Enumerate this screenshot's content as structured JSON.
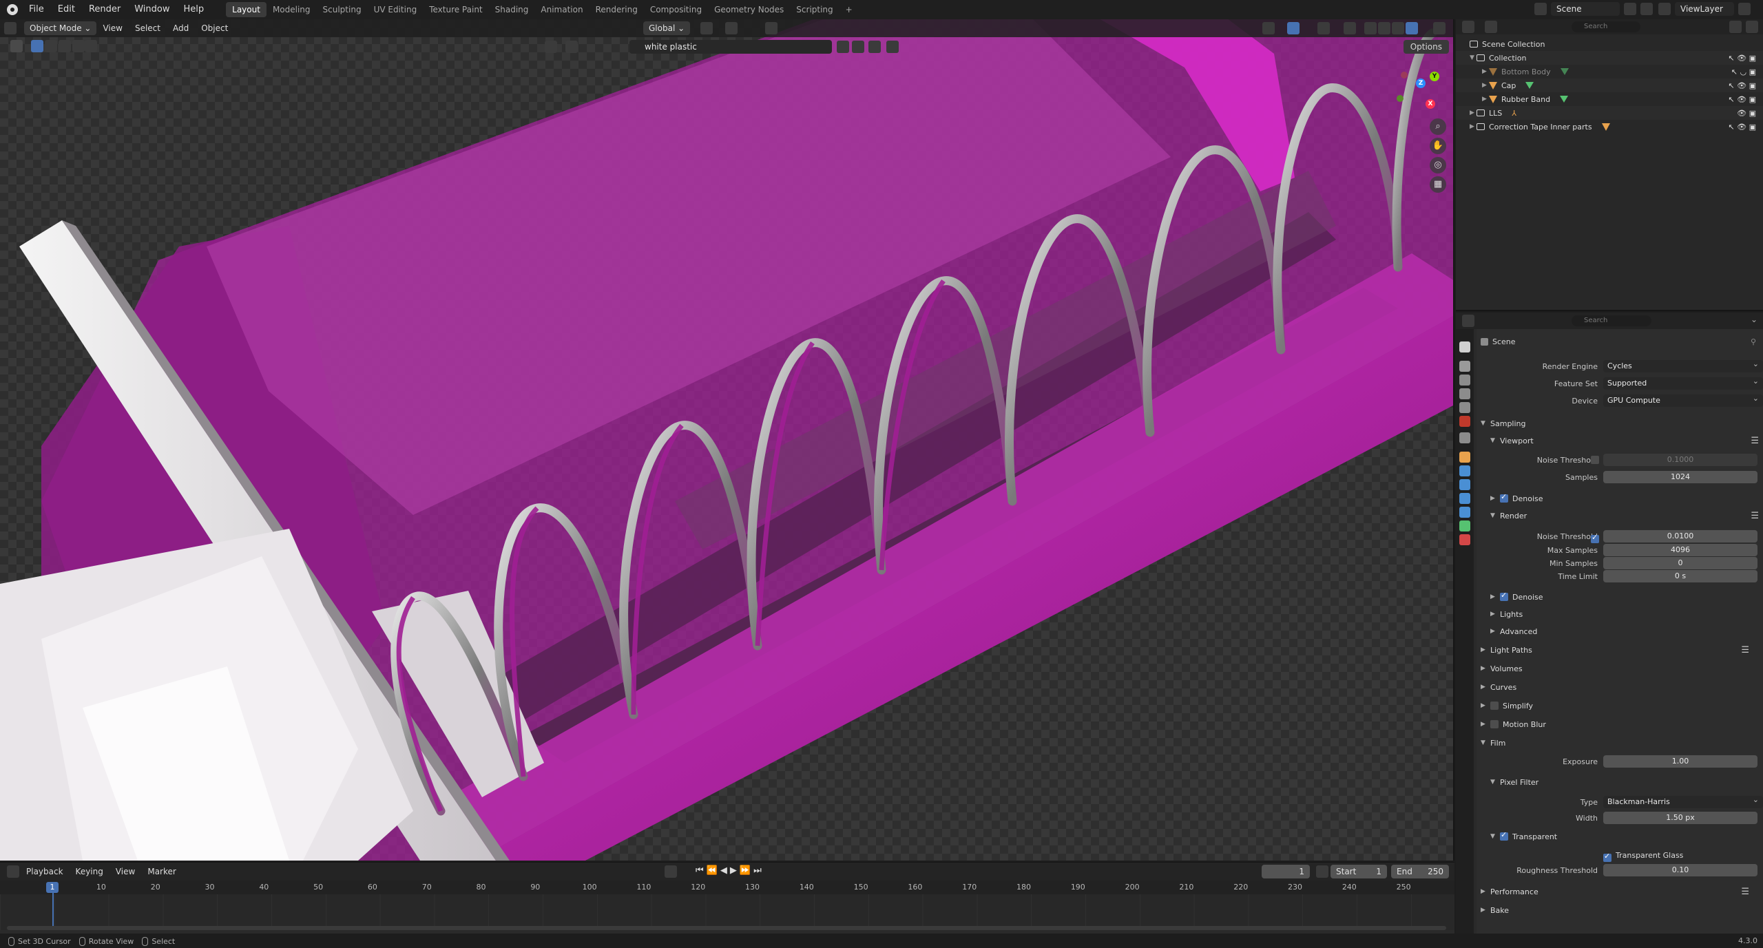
{
  "menubar": {
    "menus": [
      "File",
      "Edit",
      "Render",
      "Window",
      "Help"
    ],
    "workspaces": [
      "Layout",
      "Modeling",
      "Sculpting",
      "UV Editing",
      "Texture Paint",
      "Shading",
      "Animation",
      "Rendering",
      "Compositing",
      "Geometry Nodes",
      "Scripting"
    ],
    "active_workspace": "Layout",
    "add_tab": "+",
    "scene": "Scene",
    "view_layer": "ViewLayer"
  },
  "viewport": {
    "mode": "Object Mode",
    "menus": [
      "View",
      "Select",
      "Add",
      "Object"
    ],
    "orientation": "Global",
    "search_value": "white plastic",
    "options_label": "Options",
    "gizmo": {
      "x": "X",
      "y": "Y",
      "z": "Z"
    }
  },
  "timeline": {
    "menus": [
      "Playback",
      "Keying",
      "View",
      "Marker"
    ],
    "current_frame": "1",
    "start_label": "Start",
    "start_value": "1",
    "end_label": "End",
    "end_value": "250",
    "ruler": [
      "10",
      "20",
      "30",
      "40",
      "50",
      "60",
      "70",
      "80",
      "90",
      "100",
      "110",
      "120",
      "130",
      "140",
      "150",
      "160",
      "170",
      "180",
      "190",
      "200",
      "210",
      "220",
      "230",
      "240",
      "250"
    ],
    "playhead_frame": "1"
  },
  "statusbar": {
    "items": [
      "Set 3D Cursor",
      "Rotate View",
      "Select"
    ],
    "version": "4.3.0"
  },
  "outliner": {
    "search_placeholder": "Search",
    "root": "Scene Collection",
    "items": [
      {
        "name": "Collection"
      },
      {
        "name": "Bottom Body"
      },
      {
        "name": "Cap"
      },
      {
        "name": "Rubber Band"
      },
      {
        "name": "LLS"
      },
      {
        "name": "Correction Tape Inner parts"
      }
    ]
  },
  "properties": {
    "search_placeholder": "Search",
    "context": "Scene",
    "render_engine_label": "Render Engine",
    "render_engine": "Cycles",
    "feature_set_label": "Feature Set",
    "feature_set": "Supported",
    "device_label": "Device",
    "device": "GPU Compute",
    "sampling": "Sampling",
    "viewport": "Viewport",
    "noise_threshold_label": "Noise Threshold",
    "vp_noise_threshold": "0.1000",
    "samples_label": "Samples",
    "vp_samples": "1024",
    "denoise": "Denoise",
    "render": "Render",
    "r_noise_threshold": "0.0100",
    "max_samples_label": "Max Samples",
    "max_samples": "4096",
    "min_samples_label": "Min Samples",
    "min_samples": "0",
    "time_limit_label": "Time Limit",
    "time_limit": "0 s",
    "lights": "Lights",
    "advanced": "Advanced",
    "light_paths": "Light Paths",
    "volumes": "Volumes",
    "curves": "Curves",
    "simplify": "Simplify",
    "motion_blur": "Motion Blur",
    "film": "Film",
    "exposure_label": "Exposure",
    "exposure": "1.00",
    "pixel_filter": "Pixel Filter",
    "type_label": "Type",
    "filter_type": "Blackman-Harris",
    "width_label": "Width",
    "filter_width": "1.50 px",
    "transparent": "Transparent",
    "transparent_glass": "Transparent Glass",
    "roughness_threshold_label": "Roughness Threshold",
    "roughness_threshold": "0.10",
    "performance": "Performance",
    "bake": "Bake"
  },
  "colors": {
    "accent": "#4772b3",
    "magenta": "#c21ab0",
    "header": "#1f1f1f"
  }
}
